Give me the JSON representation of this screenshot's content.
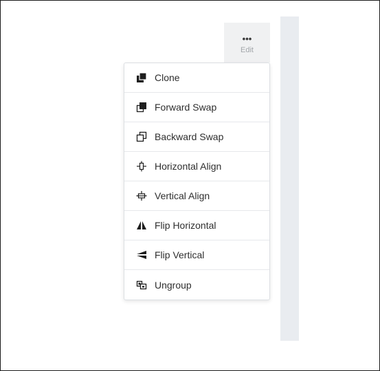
{
  "toolbar": {
    "edit_dots": "•••",
    "edit_label": "Edit"
  },
  "menu": {
    "items": [
      {
        "label": "Clone",
        "icon": "clone-icon"
      },
      {
        "label": "Forward Swap",
        "icon": "forward-swap-icon"
      },
      {
        "label": "Backward Swap",
        "icon": "backward-swap-icon"
      },
      {
        "label": "Horizontal Align",
        "icon": "horizontal-align-icon"
      },
      {
        "label": "Vertical Align",
        "icon": "vertical-align-icon"
      },
      {
        "label": "Flip Horizontal",
        "icon": "flip-horizontal-icon"
      },
      {
        "label": "Flip Vertical",
        "icon": "flip-vertical-icon"
      },
      {
        "label": "Ungroup",
        "icon": "ungroup-icon"
      }
    ]
  },
  "colors": {
    "strip": "#e9ecf0",
    "edit_bg": "#f0f1f2",
    "text": "#2e2e2e",
    "muted": "#a3a7ab"
  }
}
